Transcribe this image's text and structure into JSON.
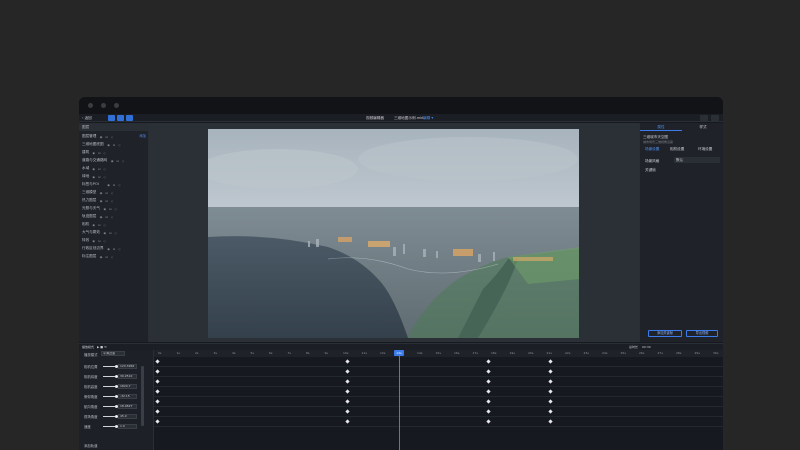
{
  "toolbar": {
    "back": "‹ 返回",
    "project": "视频编辑器",
    "file": "三维地图示例.mkt",
    "mode": "编辑 ▾",
    "accent": "#2f6fd6"
  },
  "left_panel": {
    "header": "图层",
    "items": [
      {
        "label": "图层管理",
        "right": "添加"
      },
      {
        "label": "三维地图底图"
      },
      {
        "label": "建筑"
      },
      {
        "label": "道路与交通路网"
      },
      {
        "label": "水域"
      },
      {
        "label": "绿地"
      },
      {
        "label": "标签与POI"
      },
      {
        "label": "三维模型"
      },
      {
        "label": "热力图层"
      },
      {
        "label": "光照与天气"
      },
      {
        "label": "轨迹图层"
      },
      {
        "label": "相机"
      },
      {
        "label": "大气与雾效"
      },
      {
        "label": "特效"
      },
      {
        "label": "行政区划边界"
      },
      {
        "label": "标注图层"
      }
    ]
  },
  "right_panel": {
    "tabs": [
      "属性",
      "样式"
    ],
    "title": "三维城市天空图",
    "subtitle": "城市场景三维视角渲染",
    "sub_tabs": [
      "场景设置",
      "相机设置",
      "环境设置"
    ],
    "field_label": "场景风格",
    "field_value": "默认",
    "section": "关键帧",
    "btn_left": "添加关键帧",
    "btn_right": "导出视频"
  },
  "timeline": {
    "duration_label": "总时长",
    "duration": "00:30",
    "playhead": "12s",
    "ticks": [
      "0s",
      "1s",
      "2s",
      "3s",
      "4s",
      "5s",
      "6s",
      "7s",
      "8s",
      "9s",
      "10s",
      "11s",
      "12s",
      "13s",
      "14s",
      "15s",
      "16s",
      "17s",
      "18s",
      "19s",
      "20s",
      "21s",
      "22s",
      "23s",
      "24s",
      "25s",
      "26s",
      "27s",
      "28s",
      "29s",
      "30s"
    ],
    "mode_label": "播放模式",
    "mode_value": "平滑过渡",
    "properties": [
      {
        "label": "相机位置",
        "value": "120.3956"
      },
      {
        "label": "相机纬度",
        "value": "30.2510"
      },
      {
        "label": "相机高度",
        "value": "1820.7"
      },
      {
        "label": "俯仰角度",
        "value": "-32.15"
      },
      {
        "label": "航向角度",
        "value": "18.0827"
      },
      {
        "label": "视场角度",
        "value": "45.0"
      },
      {
        "label": "速度",
        "value": "1.0"
      }
    ],
    "footer": "添加轨道"
  }
}
